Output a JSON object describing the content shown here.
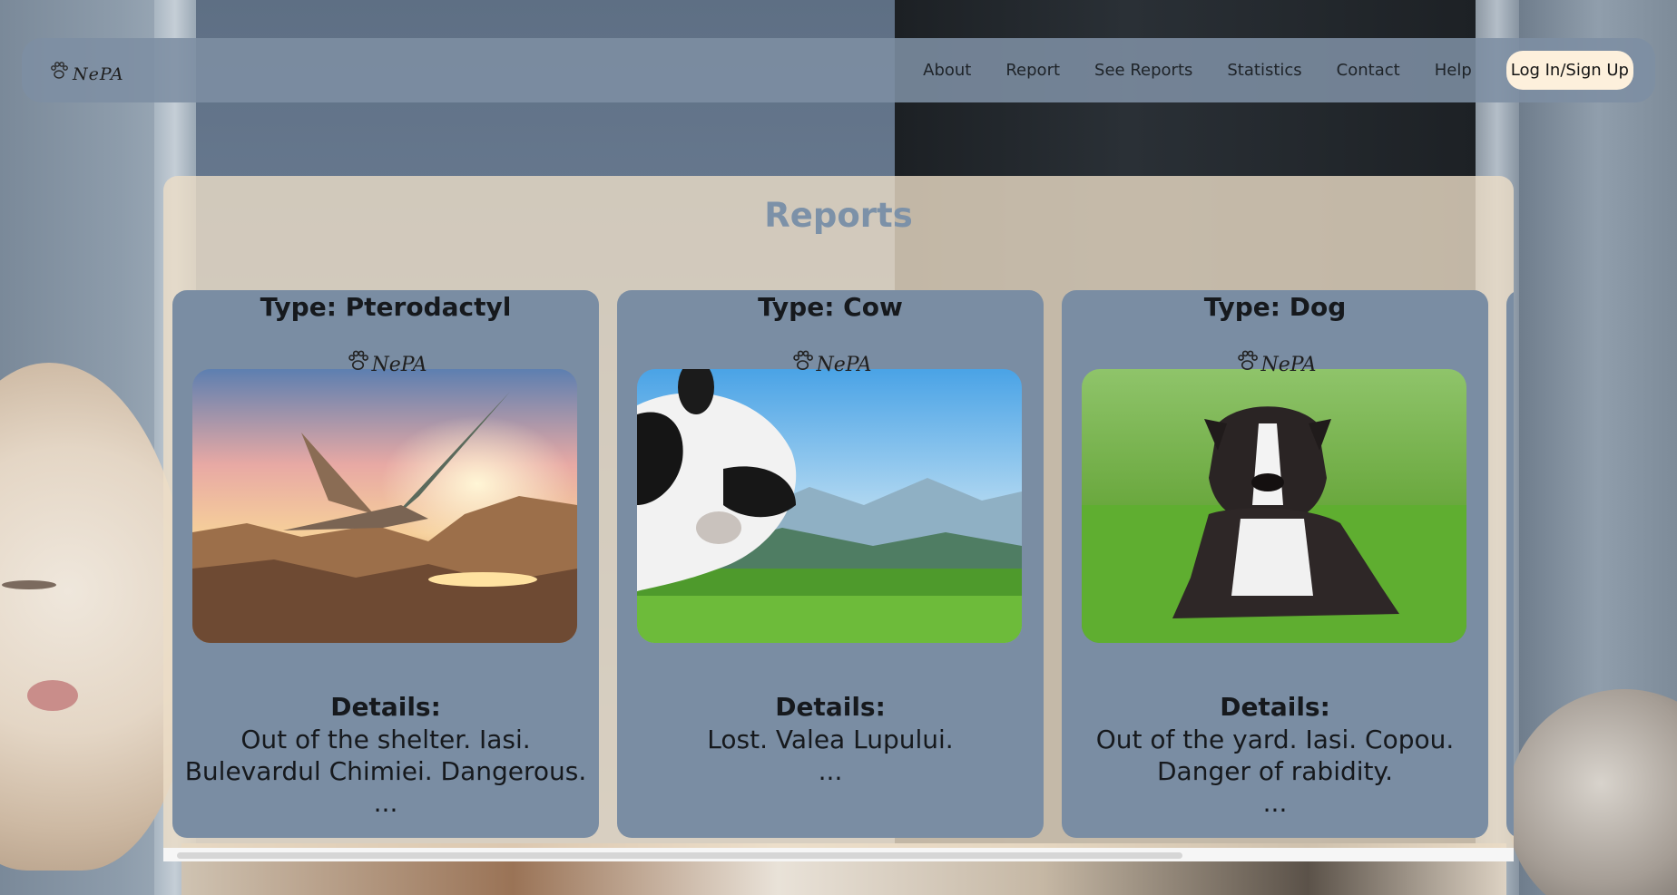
{
  "brand": {
    "logo_text": "NePA"
  },
  "nav": {
    "links": [
      "About",
      "Report",
      "See Reports",
      "Statistics",
      "Contact",
      "Help"
    ],
    "login_label": "Log In/Sign Up"
  },
  "page": {
    "title": "Reports"
  },
  "cards": [
    {
      "type": "Type: Pterodactyl",
      "details_label": "Details:",
      "details": "Out of the shelter. Iasi. Bulevardul Chimiei. Dangerous.",
      "more": "..."
    },
    {
      "type": "Type: Cow",
      "details_label": "Details:",
      "details": "Lost. Valea Lupului.",
      "more": "..."
    },
    {
      "type": "Type: Dog",
      "details_label": "Details:",
      "details": "Out of the yard. Iasi. Copou. Danger of rabidity.",
      "more": "..."
    }
  ],
  "colors": {
    "navbar": "#7d8ea3",
    "card": "#7a8da3",
    "panel": "#ecddc7",
    "title": "#7c91a8",
    "login_button": "#fdf0dc"
  }
}
